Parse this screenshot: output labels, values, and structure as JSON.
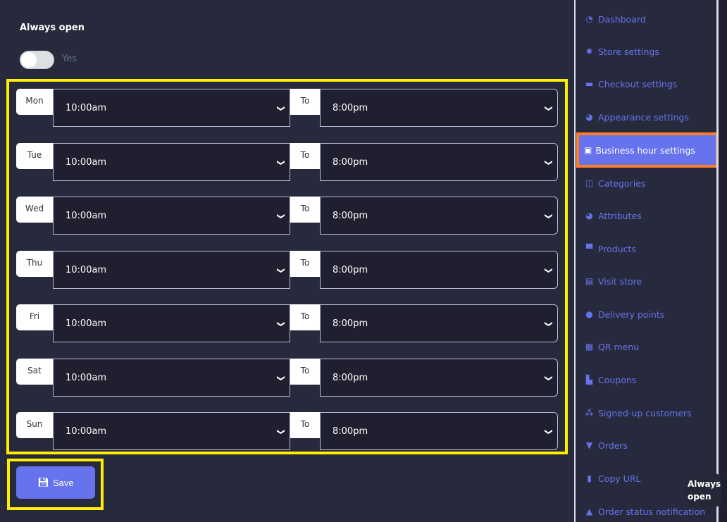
{
  "always_open": {
    "label": "Always open",
    "toggle_text": "Yes",
    "toggle_on": false
  },
  "hours": [
    {
      "day": "Mon",
      "from": "10:00am",
      "to_label": "To",
      "to": "8:00pm"
    },
    {
      "day": "Tue",
      "from": "10:00am",
      "to_label": "To",
      "to": "8:00pm"
    },
    {
      "day": "Wed",
      "from": "10:00am",
      "to_label": "To",
      "to": "8:00pm"
    },
    {
      "day": "Thu",
      "from": "10:00am",
      "to_label": "To",
      "to": "8:00pm"
    },
    {
      "day": "Fri",
      "from": "10:00am",
      "to_label": "To",
      "to": "8:00pm"
    },
    {
      "day": "Sat",
      "from": "10:00am",
      "to_label": "To",
      "to": "8:00pm"
    },
    {
      "day": "Sun",
      "from": "10:00am",
      "to_label": "To",
      "to": "8:00pm"
    }
  ],
  "save_label": "Save",
  "sidebar": {
    "items": [
      {
        "label": "Dashboard",
        "icon": "dashboard-icon",
        "glyph": "◔"
      },
      {
        "label": "Store settings",
        "icon": "gear-icon",
        "glyph": "✹"
      },
      {
        "label": "Checkout settings",
        "icon": "credit-card-icon",
        "glyph": "▬"
      },
      {
        "label": "Appearance settings",
        "icon": "palette-icon",
        "glyph": "◕"
      },
      {
        "label": "Business hour settings",
        "icon": "calendar-check-icon",
        "glyph": "▣",
        "active": true
      },
      {
        "label": "Categories",
        "icon": "columns-icon",
        "glyph": "◫"
      },
      {
        "label": "Attributes",
        "icon": "palette-icon",
        "glyph": "◕"
      },
      {
        "label": "Products",
        "icon": "box-open-icon",
        "glyph": "▀"
      },
      {
        "label": "Visit store",
        "icon": "list-alt-icon",
        "glyph": "▤"
      },
      {
        "label": "Delivery points",
        "icon": "map-marker-icon",
        "glyph": "●"
      },
      {
        "label": "QR menu",
        "icon": "qrcode-icon",
        "glyph": "▦"
      },
      {
        "label": "Coupons",
        "icon": "gifts-icon",
        "glyph": "▙"
      },
      {
        "label": "Signed-up customers",
        "icon": "users-icon",
        "glyph": "⁂"
      },
      {
        "label": "Orders",
        "icon": "cart-icon",
        "glyph": "▼"
      },
      {
        "label": "Copy URL",
        "icon": "copy-icon",
        "glyph": "▮"
      },
      {
        "label": "Order status notification",
        "icon": "bell-icon",
        "glyph": "▲"
      }
    ]
  },
  "tooltip": "Always open",
  "colors": {
    "accent": "#6673ed",
    "background": "#272a3d",
    "select_bg": "#1f1f2f",
    "highlight_yellow": "#ffee00",
    "highlight_orange": "#ff7f27"
  }
}
